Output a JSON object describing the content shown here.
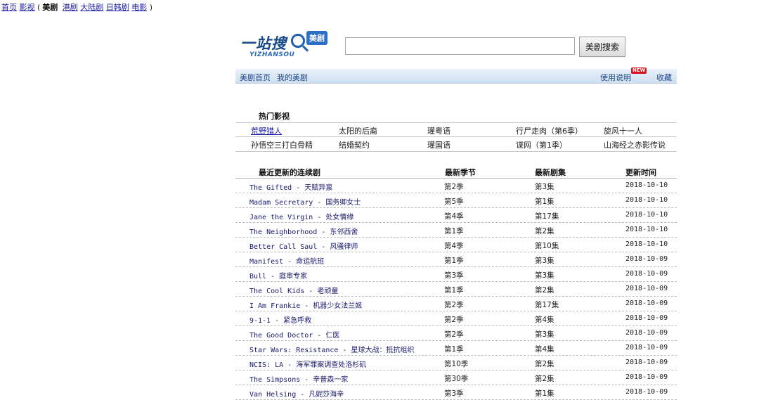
{
  "topnav": {
    "items": [
      "首页",
      "影视",
      "美剧",
      "港剧",
      "大陆剧",
      "日韩剧",
      "电影"
    ],
    "current_index": 2
  },
  "logo": {
    "text": "一站搜",
    "subtext": "YIZHANSOU",
    "badge": "美剧"
  },
  "search": {
    "value": "",
    "button_label": "美剧搜索"
  },
  "subnav": {
    "left": [
      "美剧首页",
      "我的美剧"
    ],
    "right": [
      "使用说明",
      "收藏"
    ],
    "new_badge": "NEW"
  },
  "hot": {
    "title": "热门影视",
    "rows": [
      [
        "荒野猎人",
        "太阳的后裔",
        "瓘粤语",
        "行尸走肉（第6季）",
        "旋风十一人"
      ],
      [
        "孙悟空三打白骨精",
        "结婚契约",
        "瓘国语",
        "谍网（第1季）",
        "山海经之赤影传说"
      ]
    ]
  },
  "latest": {
    "title": "最近更新的连续剧",
    "headers": [
      "最新季节",
      "最新剧集",
      "更新时间"
    ],
    "rows": [
      {
        "title": "The Gifted - 天赋异禀",
        "season": "第2季",
        "episode": "第3集",
        "date": "2018-10-10"
      },
      {
        "title": "Madam Secretary - 国务卿女士",
        "season": "第5季",
        "episode": "第1集",
        "date": "2018-10-10"
      },
      {
        "title": "Jane the Virgin - 处女情缘",
        "season": "第4季",
        "episode": "第17集",
        "date": "2018-10-10"
      },
      {
        "title": "The Neighborhood - 东邻西舍",
        "season": "第1季",
        "episode": "第2集",
        "date": "2018-10-10"
      },
      {
        "title": "Better Call Saul - 风骚律师",
        "season": "第4季",
        "episode": "第10集",
        "date": "2018-10-10"
      },
      {
        "title": "Manifest - 命运航班",
        "season": "第1季",
        "episode": "第3集",
        "date": "2018-10-09"
      },
      {
        "title": "Bull - 庭审专家",
        "season": "第3季",
        "episode": "第3集",
        "date": "2018-10-09"
      },
      {
        "title": "The Cool Kids - 老顽童",
        "season": "第1季",
        "episode": "第2集",
        "date": "2018-10-09"
      },
      {
        "title": "I Am Frankie - 机器少女法兰姬",
        "season": "第2季",
        "episode": "第17集",
        "date": "2018-10-09"
      },
      {
        "title": "9-1-1 - 紧急呼救",
        "season": "第2季",
        "episode": "第4集",
        "date": "2018-10-09"
      },
      {
        "title": "The Good Doctor - 仁医",
        "season": "第2季",
        "episode": "第3集",
        "date": "2018-10-09"
      },
      {
        "title": "Star Wars: Resistance - 星球大战：抵抗组织",
        "season": "第1季",
        "episode": "第4集",
        "date": "2018-10-09"
      },
      {
        "title": "NCIS: LA - 海军罪案调查处洛杉矶",
        "season": "第10季",
        "episode": "第2集",
        "date": "2018-10-09"
      },
      {
        "title": "The Simpsons - 辛普森一家",
        "season": "第30季",
        "episode": "第2集",
        "date": "2018-10-09"
      },
      {
        "title": "Van Helsing - 凡妮莎海辛",
        "season": "第3季",
        "episode": "第1集",
        "date": "2018-10-09"
      }
    ]
  },
  "colors": {
    "link": "#1a1aa6",
    "subnav_bg": "#dbe7f5",
    "new_badge": "#d4141c"
  }
}
